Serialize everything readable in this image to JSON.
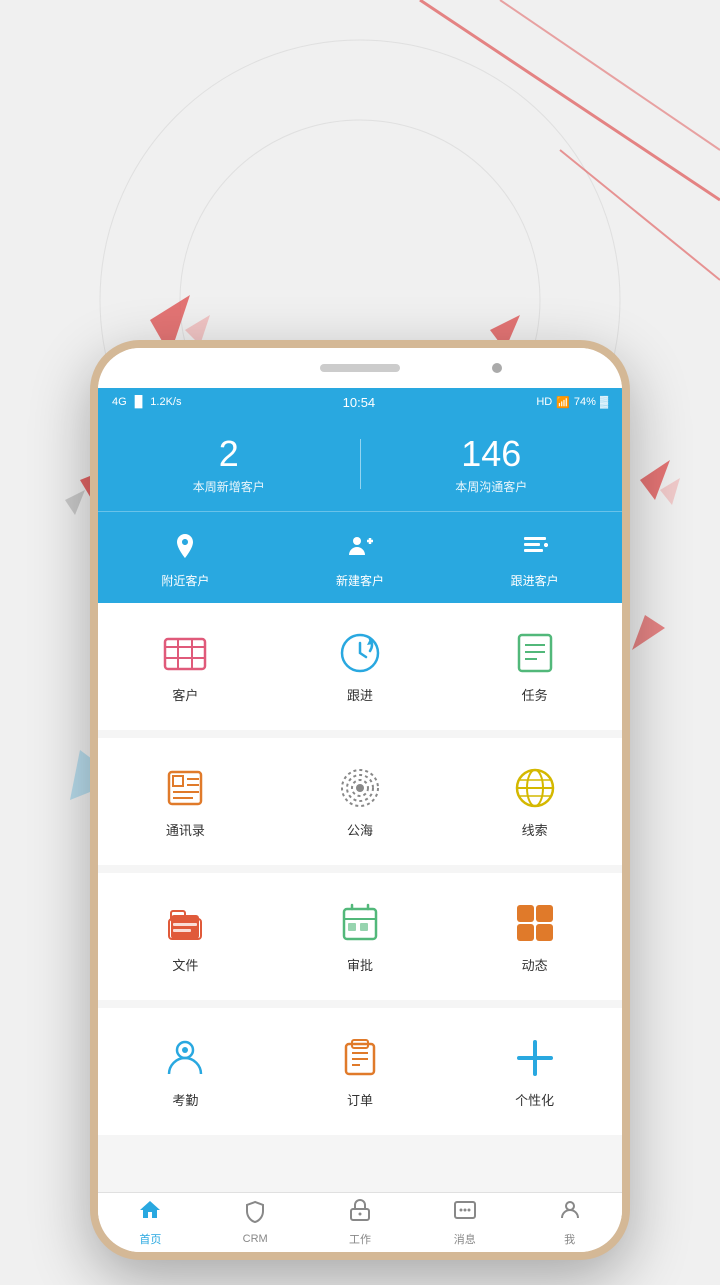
{
  "background": {
    "color": "#ececec"
  },
  "statusBar": {
    "network": "4G",
    "signal": "4G",
    "speed": "1.2K/s",
    "time": "10:54",
    "battery": "74%",
    "hd": "HD"
  },
  "header": {
    "stat1": {
      "number": "2",
      "label": "本周新增客户"
    },
    "stat2": {
      "number": "146",
      "label": "本周沟通客户"
    },
    "quickActions": [
      {
        "id": "nearby",
        "label": "附近客户",
        "icon": "📍"
      },
      {
        "id": "new",
        "label": "新建客户",
        "icon": "👤"
      },
      {
        "id": "followup",
        "label": "跟进客户",
        "icon": "📋"
      }
    ]
  },
  "grid": {
    "sections": [
      {
        "rows": [
          [
            {
              "id": "customer",
              "label": "客户",
              "icon": "🏢",
              "color": "#e05a7a"
            },
            {
              "id": "followup",
              "label": "跟进",
              "icon": "🔄",
              "color": "#29a8e0"
            },
            {
              "id": "task",
              "label": "任务",
              "icon": "📋",
              "color": "#52b87a"
            }
          ]
        ]
      },
      {
        "rows": [
          [
            {
              "id": "contacts",
              "label": "通讯录",
              "icon": "📖",
              "color": "#e07a2a"
            },
            {
              "id": "sea",
              "label": "公海",
              "icon": "🔵",
              "color": "#888"
            },
            {
              "id": "leads",
              "label": "线索",
              "icon": "🌐",
              "color": "#d4b800"
            }
          ]
        ]
      },
      {
        "rows": [
          [
            {
              "id": "file",
              "label": "文件",
              "icon": "💼",
              "color": "#e05a3a"
            },
            {
              "id": "approval",
              "label": "审批",
              "icon": "📅",
              "color": "#52b87a"
            },
            {
              "id": "dynamic",
              "label": "动态",
              "icon": "📊",
              "color": "#e07a2a"
            }
          ]
        ]
      },
      {
        "rows": [
          [
            {
              "id": "attendance",
              "label": "考勤",
              "icon": "👤",
              "color": "#29a8e0"
            },
            {
              "id": "order",
              "label": "订单",
              "icon": "📄",
              "color": "#e07a2a"
            },
            {
              "id": "personalize",
              "label": "个性化",
              "icon": "➕",
              "color": "#29a8e0"
            }
          ]
        ]
      }
    ]
  },
  "bottomNav": [
    {
      "id": "home",
      "label": "首页",
      "icon": "🏠",
      "active": true
    },
    {
      "id": "crm",
      "label": "CRM",
      "icon": "🛡",
      "active": false
    },
    {
      "id": "work",
      "label": "工作",
      "icon": "🔒",
      "active": false
    },
    {
      "id": "message",
      "label": "消息",
      "icon": "💬",
      "active": false
    },
    {
      "id": "me",
      "label": "我",
      "icon": "👤",
      "active": false
    }
  ]
}
